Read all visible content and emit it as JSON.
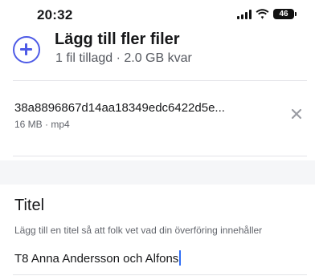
{
  "status_bar": {
    "time": "20:32",
    "battery": "46"
  },
  "add_files": {
    "title": "Lägg till fler filer",
    "subtitle": "1 fil tillagd · 2.0 GB kvar",
    "accent_color": "#4e5be6",
    "icon": "plus-circle-icon"
  },
  "files": [
    {
      "name": "38a8896867d14aa18349edc6422d5e...",
      "meta": "16 MB · mp4",
      "remove_icon": "close-icon"
    }
  ],
  "title_section": {
    "label": "Titel",
    "help": "Lägg till en titel så att folk vet vad din överföring innehåller",
    "value": "T8 Anna Andersson och Alfons"
  }
}
